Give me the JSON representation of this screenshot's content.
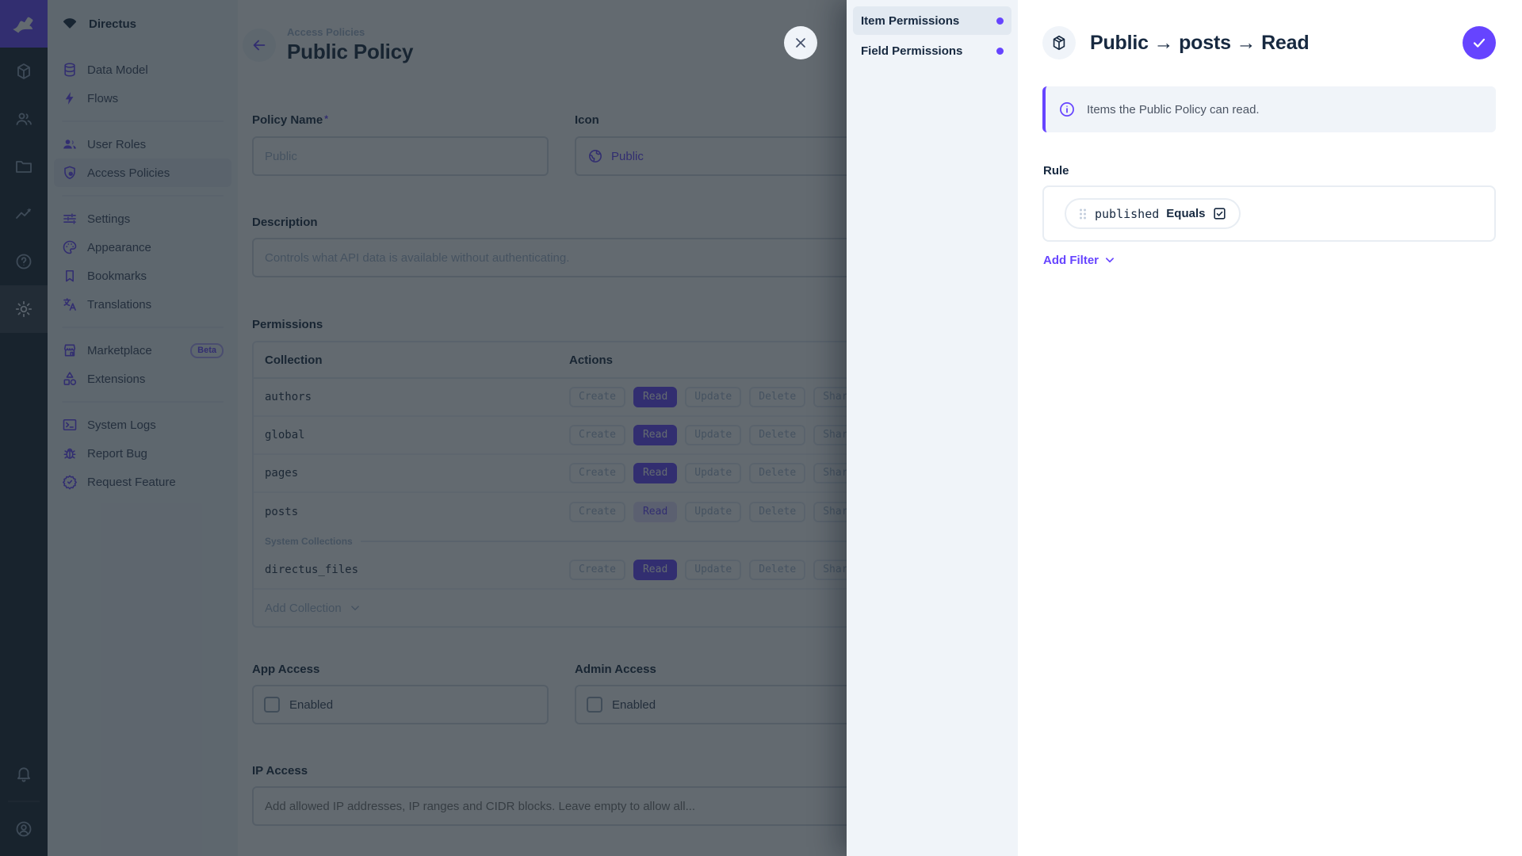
{
  "app": {
    "project_name": "Directus"
  },
  "module_bar": {
    "modules": [
      {
        "name": "content"
      },
      {
        "name": "users"
      },
      {
        "name": "files"
      },
      {
        "name": "insights"
      },
      {
        "name": "help"
      },
      {
        "name": "settings"
      }
    ]
  },
  "nav": {
    "items": [
      {
        "label": "Data Model"
      },
      {
        "label": "Flows"
      },
      {
        "label": "User Roles"
      },
      {
        "label": "Access Policies"
      },
      {
        "label": "Settings"
      },
      {
        "label": "Appearance"
      },
      {
        "label": "Bookmarks"
      },
      {
        "label": "Translations"
      },
      {
        "label": "Marketplace",
        "badge": "Beta"
      },
      {
        "label": "Extensions"
      },
      {
        "label": "System Logs"
      },
      {
        "label": "Report Bug"
      },
      {
        "label": "Request Feature"
      }
    ]
  },
  "page": {
    "breadcrumb": "Access Policies",
    "title": "Public Policy"
  },
  "form": {
    "policy_name": {
      "label": "Policy Name",
      "required_mark": "*",
      "value": "Public"
    },
    "icon": {
      "label": "Icon",
      "value": "Public"
    },
    "description": {
      "label": "Description",
      "value": "Controls what API data is available without authenticating."
    },
    "app_access": {
      "label": "App Access",
      "checkbox_label": "Enabled"
    },
    "admin_access": {
      "label": "Admin Access",
      "checkbox_label": "Enabled"
    },
    "ip_access": {
      "label": "IP Access",
      "placeholder": "Add allowed IP addresses, IP ranges and CIDR blocks. Leave empty to allow all..."
    }
  },
  "permissions": {
    "label": "Permissions",
    "columns": {
      "collection": "Collection",
      "actions": "Actions"
    },
    "actions": [
      "Create",
      "Read",
      "Update",
      "Delete",
      "Share"
    ],
    "rows": [
      {
        "collection": "authors",
        "read_state": "full"
      },
      {
        "collection": "global",
        "read_state": "full"
      },
      {
        "collection": "pages",
        "read_state": "full"
      },
      {
        "collection": "posts",
        "read_state": "partial"
      },
      {
        "collection": "directus_files",
        "read_state": "full"
      }
    ],
    "system_divider": "System Collections",
    "add_collection": "Add Collection"
  },
  "drawer": {
    "tabs": [
      {
        "label": "Item Permissions",
        "active": true
      },
      {
        "label": "Field Permissions",
        "active": false
      }
    ],
    "title": "Public → posts → Read",
    "notice": "Items the Public Policy can read.",
    "rule_label": "Rule",
    "filter": {
      "field": "published",
      "operator": "Equals"
    },
    "add_filter": "Add Filter"
  },
  "colors": {
    "accent": "#6644ff",
    "module_bar_bg": "#18222f",
    "sidebar_bg": "#f0f4f9",
    "text_dark": "#172940",
    "text_subdued": "#a2b5cd",
    "border": "#d3dae4",
    "border_subdued": "#e4eaf1"
  }
}
